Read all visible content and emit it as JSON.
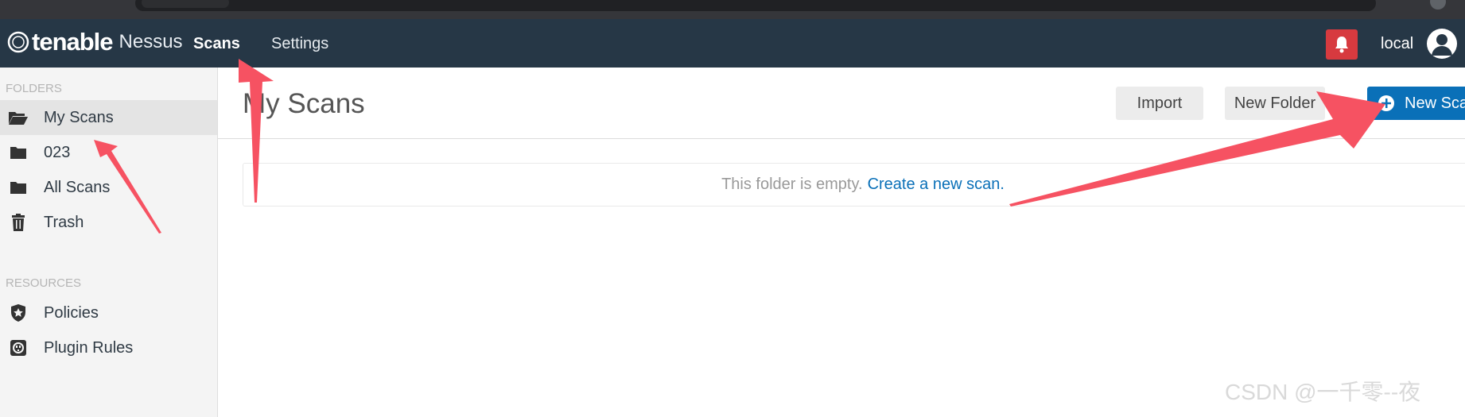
{
  "topnav": {
    "brand": "tenable",
    "product": "Nessus",
    "links": [
      {
        "label": "Scans",
        "active": true
      },
      {
        "label": "Settings",
        "active": false
      }
    ],
    "user": "local",
    "notification_icon": "bell-icon",
    "avatar_icon": "user-icon"
  },
  "sidebar": {
    "folders_label": "FOLDERS",
    "folders": [
      {
        "label": "My Scans",
        "icon": "folder-open-icon",
        "active": true
      },
      {
        "label": "023",
        "icon": "folder-icon",
        "active": false
      },
      {
        "label": "All Scans",
        "icon": "folder-icon",
        "active": false
      },
      {
        "label": "Trash",
        "icon": "trash-icon",
        "active": false
      }
    ],
    "resources_label": "RESOURCES",
    "resources": [
      {
        "label": "Policies",
        "icon": "shield-star-icon"
      },
      {
        "label": "Plugin Rules",
        "icon": "plugin-icon"
      }
    ]
  },
  "main": {
    "title": "My Scans",
    "buttons": {
      "import": "Import",
      "new_folder": "New Folder",
      "new_scan": "New Scan"
    },
    "empty_message": "This folder is empty.",
    "empty_link": "Create a new scan."
  },
  "watermark": "CSDN @一千零--夜",
  "colors": {
    "nav_bg": "#263746",
    "primary": "#0a70b8",
    "alert": "#d73a3f",
    "annotation_arrow": "#f65262"
  }
}
